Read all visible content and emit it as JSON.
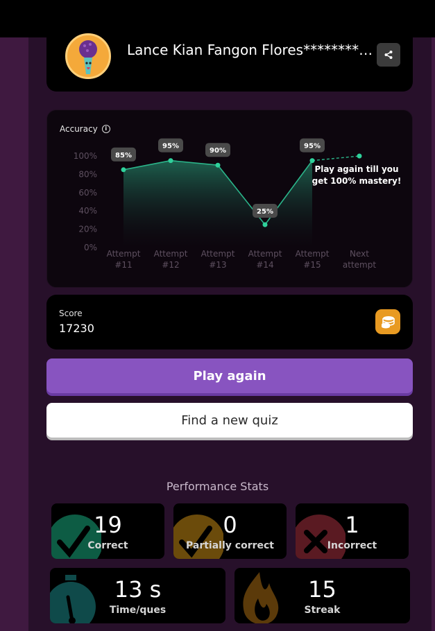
{
  "profile": {
    "name": "Lance Kian Fangon Flores**********..."
  },
  "accuracy": {
    "title": "Accuracy",
    "hint": "Play again till you get 100% mastery!",
    "y_ticks": [
      "100%",
      "80%",
      "60%",
      "40%",
      "20%",
      "0%"
    ]
  },
  "chart_data": {
    "type": "area",
    "title": "Accuracy",
    "categories": [
      "Attempt #11",
      "Attempt #12",
      "Attempt #13",
      "Attempt #14",
      "Attempt #15",
      "Next attempt"
    ],
    "values": [
      85,
      95,
      90,
      25,
      95,
      100
    ],
    "data_labels": [
      "85%",
      "95%",
      "90%",
      "25%",
      "95%",
      ""
    ],
    "ylim": [
      0,
      100
    ],
    "colors": {
      "line": "#2bb58a",
      "dashed": "#2bb58a"
    }
  },
  "score": {
    "label": "Score",
    "value": "17230"
  },
  "buttons": {
    "play_again": "Play again",
    "find_quiz": "Find a new quiz"
  },
  "performance": {
    "title": "Performance Stats",
    "correct": {
      "value": "19",
      "label": "Correct"
    },
    "partial": {
      "value": "0",
      "label": "Partially correct"
    },
    "incorrect": {
      "value": "1",
      "label": "Incorrect"
    },
    "time": {
      "value": "13 s",
      "label": "Time/ques"
    },
    "streak": {
      "value": "15",
      "label": "Streak"
    }
  },
  "colors": {
    "accent": "#8854c0",
    "correct": "#0d5c44",
    "partial": "#6b4b0b",
    "incorrect": "#5a1a22",
    "time": "#0f4a4a",
    "streak": "#5b3a0a"
  }
}
